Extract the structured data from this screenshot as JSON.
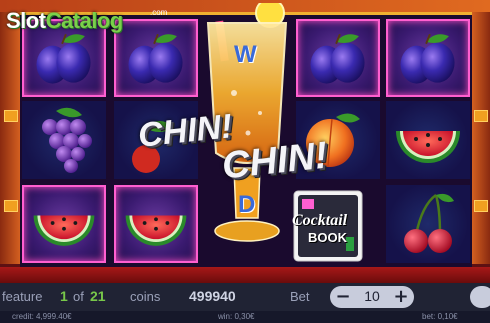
{
  "brand": {
    "logo_main": "Slot",
    "logo_accent": "Catalog",
    "logo_suffix": ".com"
  },
  "game": {
    "title_line1": "CHIN!",
    "title_line2": "CHIN!",
    "book_line1": "Cocktail",
    "book_line2": "BOOK",
    "glass_letters": [
      "W",
      "D"
    ]
  },
  "reels": {
    "symbols": [
      [
        "plum",
        "plum",
        "cocktail-wild",
        "plum",
        "plum"
      ],
      [
        "grapes",
        "orange",
        "cocktail-wild",
        "peach",
        "watermelon"
      ],
      [
        "watermelon",
        "watermelon",
        "cocktail-wild",
        "book-scatter",
        "cherries"
      ]
    ]
  },
  "bottom_bar": {
    "feature_label": "feature",
    "feature_current": "1",
    "feature_of": "of",
    "feature_total": "21",
    "coins_label": "coins",
    "coins_value": "499940",
    "bet_label": "Bet",
    "bet_value": "10",
    "minus_symbol": "−",
    "plus_symbol": "+"
  },
  "info_bar": {
    "credit": "credit: 4,999.40€",
    "win": "win: 0,30€",
    "bet": "bet: 0,10€"
  },
  "colors": {
    "accent": "#78c84a",
    "frame": "#ff5fd0",
    "reel_border": "#f0b030"
  }
}
